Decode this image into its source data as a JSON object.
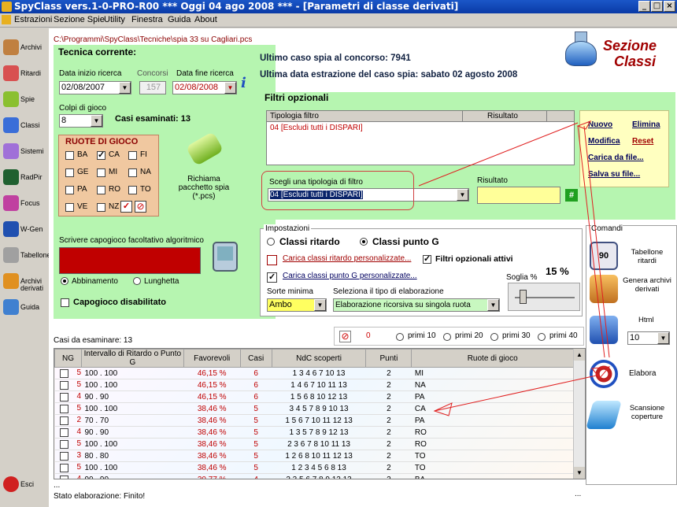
{
  "window": {
    "title": "SpyClass vers.1-0-PRO-R00 *** Oggi 04 ago 2008 *** - [Parametri di classe derivati]"
  },
  "menu": [
    "Estrazioni",
    "Sezione Spie",
    "Utility",
    "Finestra",
    "Guida",
    "About"
  ],
  "toolbar": [
    {
      "label": "Archivi",
      "icon": "pencil-icon",
      "color": "#c08040"
    },
    {
      "label": "Ritardi",
      "icon": "clock-icon",
      "color": "#d85050"
    },
    {
      "label": "Spie",
      "icon": "flashlight-icon",
      "color": "#8ac030"
    },
    {
      "label": "Classi",
      "icon": "flask-icon",
      "color": "#3a6ed8"
    },
    {
      "label": "Sistemi",
      "icon": "bulb-icon",
      "color": "#a070d8"
    },
    {
      "label": "RadPir",
      "icon": "pyramid-icon",
      "color": "#206030"
    },
    {
      "label": "Focus",
      "icon": "dots-icon",
      "color": "#c040a0"
    },
    {
      "label": "W-Gen",
      "icon": "globe-icon",
      "color": "#2050b0"
    },
    {
      "label": "Tabellone",
      "icon": "board-icon",
      "color": "#a0a0a0"
    },
    {
      "label": "Archivi derivati",
      "icon": "cabinet-icon",
      "color": "#e09020"
    },
    {
      "label": "Guida",
      "icon": "book-icon",
      "color": "#4080d0"
    }
  ],
  "exit_label": "Esci",
  "path": "C:\\Programmi\\SpyClass\\Tecniche\\spia 33 su Cagliari.pcs",
  "tecnica": {
    "title": "Tecnica corrente:",
    "data_inizio_label": "Data inizio ricerca",
    "data_inizio": "02/08/2007",
    "concorsi_label": "Concorsi",
    "concorsi": "157",
    "data_fine_label": "Data fine ricerca",
    "data_fine": "02/08/2008",
    "colpi_label": "Colpi di gioco",
    "colpi": "8",
    "casi_esaminati": "Casi esaminati: 13",
    "ruote_title": "RUOTE DI GIOCO",
    "ruote": [
      {
        "n": "BA",
        "c": false
      },
      {
        "n": "CA",
        "c": true
      },
      {
        "n": "FI",
        "c": false
      },
      {
        "n": "GE",
        "c": false
      },
      {
        "n": "MI",
        "c": false
      },
      {
        "n": "NA",
        "c": false
      },
      {
        "n": "PA",
        "c": false
      },
      {
        "n": "RO",
        "c": false
      },
      {
        "n": "TO",
        "c": false
      },
      {
        "n": "VE",
        "c": false
      },
      {
        "n": "NZ",
        "c": false
      }
    ],
    "richiama": "Richiama pacchetto spia (*.pcs)",
    "capogioco_label": "Scrivere capogioco facoltativo algoritmico",
    "abbinamento": "Abbinamento",
    "lunghetta": "Lunghetta",
    "capogioco_dis": "Capogioco disabilitato"
  },
  "info": {
    "ultimo": "Ultimo caso spia al concorso: 7941",
    "ultima": "Ultima data estrazione del caso spia: sabato 02 agosto 2008"
  },
  "header": {
    "l1": "Sezione",
    "l2": "Classi"
  },
  "filtri": {
    "title": "Filtri opzionali",
    "col1": "Tipologia filtro",
    "col2": "Risultato",
    "row": "04 [Escludi tutti i DISPARI]",
    "scegli": "Scegli una tipologia di filtro",
    "scelto": "04 [Escludi tutti i DISPARI]",
    "risultato": "Risultato",
    "hash": "#"
  },
  "links": {
    "nuovo": "Nuovo",
    "elimina": "Elimina",
    "modifica": "Modifica",
    "reset": "Reset",
    "carica": "Carica da file...",
    "salva": "Salva su file..."
  },
  "impost": {
    "title": "Impostazioni",
    "classi_ritardo": "Classi ritardo",
    "classi_punto": "Classi punto G",
    "carica_rit": "Carica classi ritardo personalizzate...",
    "filtri_att": "Filtri opzionali attivi",
    "carica_pun": "Carica classi punto G personalizzate...",
    "soglia_label": "Soglia %",
    "soglia": "15 %",
    "sorte_label": "Sorte minima",
    "sorte": "Ambo",
    "tipo_label": "Seleziona il tipo di elaborazione",
    "tipo": "Elaborazione ricorsiva su singola ruota"
  },
  "primi": {
    "zero": "0",
    "opts": [
      "primi 10",
      "primi 20",
      "primi 30",
      "primi 40"
    ]
  },
  "comandi": {
    "title": "Comandi",
    "tabelloni": "Tabellone ritardi",
    "genera": "Genera archivi derivati",
    "html": "Html",
    "html_val": "10",
    "elabora": "Elabora",
    "scansione": "Scansione coperture"
  },
  "grid": {
    "title": "Casi da esaminare: 13",
    "headers": [
      "NG",
      "Intervallo di Ritardo o Punto G",
      "Favorevoli",
      "Casi",
      "NdC scoperti",
      "Punti",
      "Ruote di gioco"
    ],
    "rows": [
      [
        "5",
        "100 . 100",
        "46,15 %",
        "6",
        "1 3 4 6 7 10 13",
        "2",
        "MI"
      ],
      [
        "5",
        "100 . 100",
        "46,15 %",
        "6",
        "1 4 6 7 10 11 13",
        "2",
        "NA"
      ],
      [
        "4",
        "90 . 90",
        "46,15 %",
        "6",
        "1 5 6 8 10 12 13",
        "2",
        "PA"
      ],
      [
        "5",
        "100 . 100",
        "38,46 %",
        "5",
        "3 4 5 7 8 9 10 13",
        "2",
        "CA"
      ],
      [
        "2",
        "70 . 70",
        "38,46 %",
        "5",
        "1 5 6 7 10 11 12 13",
        "2",
        "PA"
      ],
      [
        "4",
        "90 . 90",
        "38,46 %",
        "5",
        "1 3 5 7 8 9 12 13",
        "2",
        "RO"
      ],
      [
        "5",
        "100 . 100",
        "38,46 %",
        "5",
        "2 3 6 7 8 10 11 13",
        "2",
        "RO"
      ],
      [
        "3",
        "80 . 80",
        "38,46 %",
        "5",
        "1 2 6 8 10 11 12 13",
        "2",
        "TO"
      ],
      [
        "5",
        "100 . 100",
        "38,46 %",
        "5",
        "1 2 3 4 5 6 8 13",
        "2",
        "TO"
      ],
      [
        "4",
        "90 . 90",
        "30,77 %",
        "4",
        "2 3 5 6 7 8 9 12 13",
        "2",
        "BA"
      ]
    ]
  },
  "status": {
    "dots": "...",
    "text": "Stato elaborazione: Finito!",
    "right": "..."
  }
}
